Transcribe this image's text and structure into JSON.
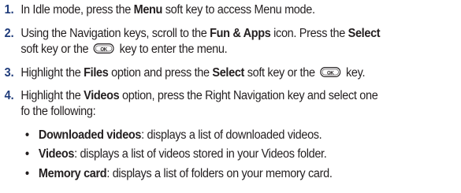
{
  "steps": [
    {
      "number": "1.",
      "parts": [
        "In Idle mode, press the ",
        "Menu",
        " soft key to access Menu mode."
      ]
    },
    {
      "number": "2.",
      "line1": [
        "Using the Navigation keys, scroll to the ",
        "Fun & Apps",
        " icon. Press the ",
        "Select"
      ],
      "line2": [
        "soft key or the ",
        " key to enter the menu."
      ]
    },
    {
      "number": "3.",
      "parts": [
        "Highlight the ",
        "Files",
        " option and press the ",
        "Select",
        " soft key or the ",
        " key."
      ]
    },
    {
      "number": "4.",
      "line1": [
        "Highlight the ",
        "Videos",
        " option, press the Right Navigation key and select one"
      ],
      "line2": "fo the following:"
    }
  ],
  "bullets": [
    {
      "term": "Downloaded videos",
      "desc": ": displays a list of downloaded videos."
    },
    {
      "term": "Videos",
      "desc": ": displays a list of videos stored in your Videos folder."
    },
    {
      "term": "Memory card",
      "desc": ": displays a list of folders on your memory card."
    }
  ],
  "icons": {
    "ok_key": "ok-key-icon",
    "bullet": "bullet-dot"
  },
  "key_label": "OK",
  "bullet_glyph": "•",
  "colors": {
    "step_number": "#1f3b7a",
    "text": "#231f20"
  }
}
